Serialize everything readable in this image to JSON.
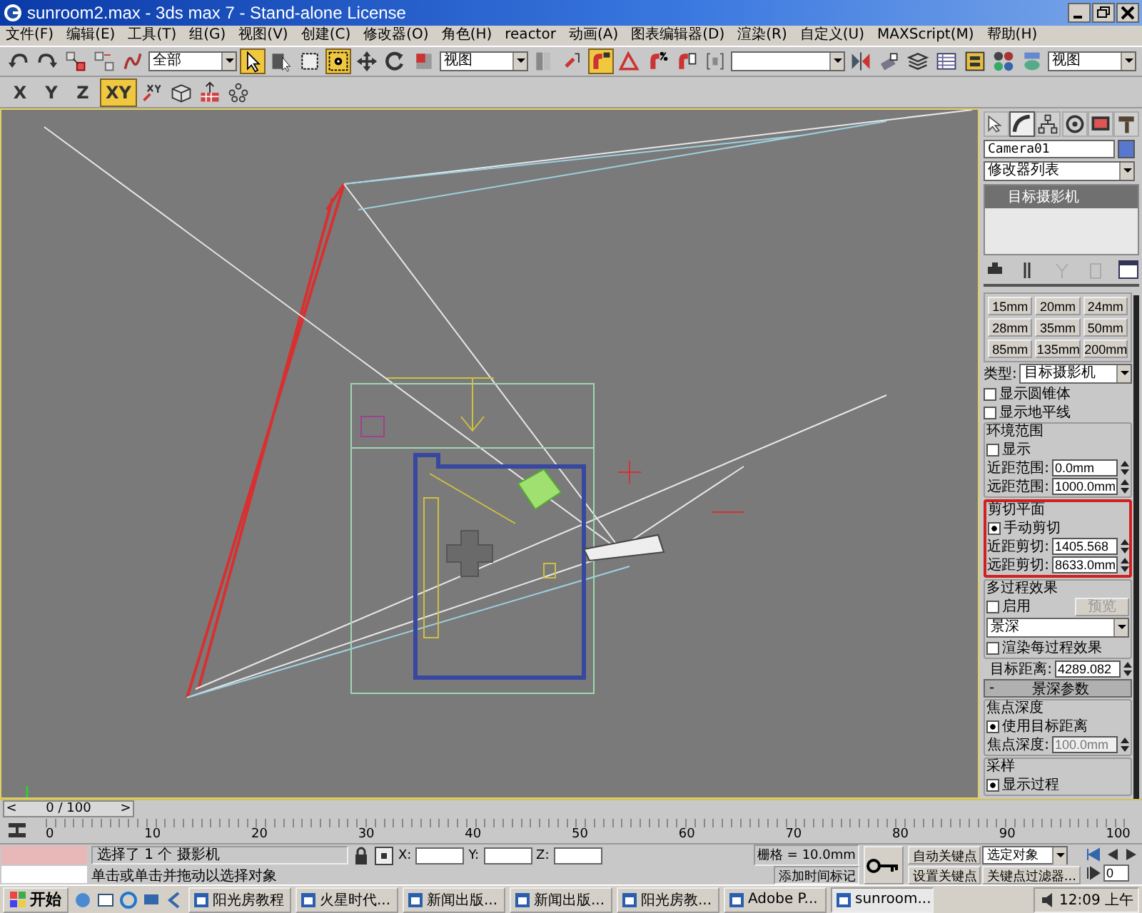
{
  "window": {
    "title": "sunroom2.max - 3ds max 7  - Stand-alone License"
  },
  "menu_bar": [
    "文件(F)",
    "编辑(E)",
    "工具(T)",
    "组(G)",
    "视图(V)",
    "创建(C)",
    "修改器(O)",
    "角色(H)",
    "reactor",
    "动画(A)",
    "图表编辑器(D)",
    "渲染(R)",
    "自定义(U)",
    "MAXScript(M)",
    "帮助(H)"
  ],
  "main_toolbar": [
    {
      "kind": "icon",
      "selected": false
    },
    {
      "kind": "icon",
      "selected": false
    },
    {
      "kind": "icon",
      "selected": false
    },
    {
      "kind": "icon",
      "selected": false
    },
    {
      "kind": "icon",
      "selected": false
    },
    {
      "kind": "dropdown",
      "value": "全部"
    },
    {
      "kind": "icon",
      "selected": true
    },
    {
      "kind": "icon",
      "selected": false
    },
    {
      "kind": "icon",
      "selected": false
    },
    {
      "kind": "icon",
      "selected": true
    },
    {
      "kind": "icon",
      "selected": false
    },
    {
      "kind": "icon",
      "selected": false
    },
    {
      "kind": "icon",
      "selected": false
    },
    {
      "kind": "dropdown",
      "value": "视图"
    },
    {
      "kind": "icon",
      "selected": false
    },
    {
      "kind": "icon",
      "selected": false
    },
    {
      "kind": "icon",
      "selected": true
    },
    {
      "kind": "icon",
      "selected": false
    },
    {
      "kind": "icon",
      "selected": false
    },
    {
      "kind": "icon",
      "selected": false
    },
    {
      "kind": "icon",
      "selected": false
    },
    {
      "kind": "dropdown"
    },
    {
      "kind": "icon",
      "selected": false
    },
    {
      "kind": "icon",
      "selected": false
    },
    {
      "kind": "icon",
      "selected": false
    },
    {
      "kind": "icon",
      "selected": false
    },
    {
      "kind": "icon",
      "selected": false
    },
    {
      "kind": "icon",
      "selected": false
    },
    {
      "kind": "icon",
      "selected": false
    },
    {
      "kind": "dropdown",
      "value": "视图"
    }
  ],
  "axis_toolbar": [
    {
      "kind": "axis",
      "label": "X",
      "selected": false
    },
    {
      "kind": "axis",
      "label": "Y",
      "selected": false
    },
    {
      "kind": "axis",
      "label": "Z",
      "selected": false
    },
    {
      "kind": "axis",
      "label": "XY",
      "selected": true
    },
    {
      "kind": "icon",
      "selected": false
    },
    {
      "kind": "icon",
      "selected": false
    },
    {
      "kind": "icon",
      "selected": false
    },
    {
      "kind": "icon",
      "selected": false
    }
  ],
  "command_panel": {
    "tabs": [
      {
        "selected": false
      },
      {
        "selected": true
      },
      {
        "selected": false
      },
      {
        "selected": false
      },
      {
        "selected": false
      },
      {
        "selected": false
      }
    ],
    "object_name": "Camera01",
    "modifier_list": "修改器列表",
    "stack": [
      {
        "label": "目标摄影机",
        "selected": true
      }
    ],
    "rows": [
      {
        "kind": "lens_grid",
        "buttons": [
          "15mm",
          "20mm",
          "24mm",
          "28mm",
          "35mm",
          "50mm",
          "85mm",
          "135mm",
          "200mm"
        ]
      },
      {
        "kind": "select",
        "label": "类型:",
        "value": "目标摄影机"
      },
      {
        "kind": "checkbox",
        "label": "显示圆锥体",
        "checked": false
      },
      {
        "kind": "checkbox",
        "label": "显示地平线",
        "checked": false
      },
      {
        "kind": "group",
        "title": "环境范围",
        "highlighted": false,
        "rows": [
          {
            "kind": "checkbox",
            "label": "显示",
            "checked": false
          },
          {
            "kind": "spinner",
            "label": "近距范围:",
            "value": "0.0mm",
            "disabled": false
          },
          {
            "kind": "spinner",
            "label": "远距范围:",
            "value": "1000.0mm",
            "disabled": false
          }
        ]
      },
      {
        "kind": "group",
        "title": "剪切平面",
        "highlighted": true,
        "rows": [
          {
            "kind": "checkbox",
            "label": "手动剪切",
            "checked": true
          },
          {
            "kind": "spinner",
            "label": "近距剪切:",
            "value": "1405.568",
            "disabled": false
          },
          {
            "kind": "spinner",
            "label": "远距剪切:",
            "value": "8633.0mm",
            "disabled": false
          }
        ]
      },
      {
        "kind": "group",
        "title": "多过程效果",
        "highlighted": false,
        "rows": [
          {
            "kind": "checkbox_button",
            "label": "启用",
            "checked": false,
            "button": "预览",
            "disabled": true
          },
          {
            "kind": "select",
            "value": "景深"
          },
          {
            "kind": "checkbox",
            "label": "渲染每过程效果",
            "checked": false
          }
        ]
      },
      {
        "kind": "spinner",
        "label": "目标距离:",
        "value": "4289.082",
        "disabled": false
      },
      {
        "kind": "rollout_header",
        "sign": "-",
        "label": "景深参数"
      },
      {
        "kind": "group",
        "title": "焦点深度",
        "highlighted": false,
        "rows": [
          {
            "kind": "checkbox",
            "label": "使用目标距离",
            "checked": true
          },
          {
            "kind": "spinner",
            "label": "焦点深度:",
            "value": "100.0mm",
            "disabled": true
          }
        ]
      },
      {
        "kind": "group",
        "title": "采样",
        "highlighted": false,
        "rows": [
          {
            "kind": "checkbox",
            "label": "显示过程",
            "checked": true
          }
        ]
      }
    ]
  },
  "time_slider": {
    "label": "0 / 100",
    "prev": "<",
    "next": ">",
    "level": 0
  },
  "track_bar": {
    "labels": [
      "0",
      "10",
      "20",
      "30",
      "40",
      "50",
      "60",
      "70",
      "80",
      "90",
      "100"
    ]
  },
  "status_bar": {
    "selection": "选择了 1 个 摄影机",
    "prompt": "单击或单击并拖动以选择对象",
    "coords": [
      "X:",
      "Y:",
      "Z:"
    ],
    "grid": "栅格 = 10.0mm",
    "time_tag": "添加时间标记",
    "auto_key": "自动关键点",
    "set_key": "设置关键点",
    "key_mode": "选定对象",
    "key_filters": "关键点过滤器...",
    "frame": "0"
  },
  "taskbar": {
    "start": "开始",
    "tasks": [
      {
        "label": "阳光房教程",
        "selected": false
      },
      {
        "label": "火星时代...",
        "selected": false
      },
      {
        "label": "新闻出版...",
        "selected": false
      },
      {
        "label": "新闻出版...",
        "selected": false
      },
      {
        "label": "阳光房教...",
        "selected": false
      },
      {
        "label": "Adobe P...",
        "selected": false
      },
      {
        "label": "sunroom...",
        "selected": true
      }
    ],
    "clock": "12:09 上午"
  }
}
